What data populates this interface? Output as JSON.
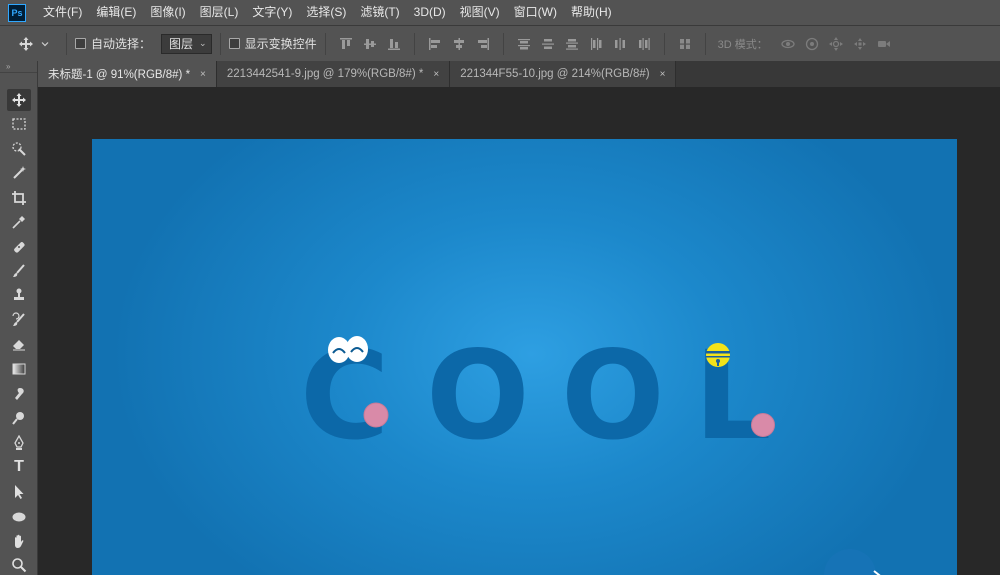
{
  "app": {
    "logo_text": "Ps",
    "brand_color": "#31a8ff"
  },
  "menu": [
    "文件(F)",
    "编辑(E)",
    "图像(I)",
    "图层(L)",
    "文字(Y)",
    "选择(S)",
    "滤镜(T)",
    "3D(D)",
    "视图(V)",
    "窗口(W)",
    "帮助(H)"
  ],
  "options": {
    "auto_select_label": "自动选择：",
    "auto_select_target": "图层",
    "show_transform_label": "显示变换控件",
    "mode_3d_label": "3D 模式："
  },
  "tabs": [
    {
      "label": "未标题-1 @ 91%(RGB/8#) *",
      "active": true,
      "close": "×"
    },
    {
      "label": "2213442541-9.jpg @ 179%(RGB/8#) *",
      "active": false,
      "close": "×"
    },
    {
      "label": "221344F55-10.jpg @ 214%(RGB/8#)",
      "active": false,
      "close": "×"
    }
  ],
  "toolbar": {
    "header": "»",
    "tools": [
      "move-tool",
      "marquee-tool",
      "lasso-tool",
      "magic-wand-tool",
      "crop-tool",
      "eyedropper-tool",
      "healing-brush-tool",
      "brush-tool",
      "clone-stamp-tool",
      "history-brush-tool",
      "eraser-tool",
      "gradient-tool",
      "blur-tool",
      "dodge-tool",
      "pen-tool",
      "type-tool",
      "path-selection-tool",
      "ellipse-tool",
      "hand-tool",
      "zoom-tool"
    ],
    "type_tool_glyph": "T"
  },
  "canvas_art": {
    "letters": [
      "C",
      "O",
      "O",
      "L"
    ],
    "letter_color": "#0c68a8",
    "cheek_color": "#d98aa8",
    "bell_color": "#f3e31a"
  },
  "colors": {
    "ui_panel": "#535353",
    "workspace": "#282828",
    "canvas_center": "#2e9fe2",
    "canvas_edge": "#1272b2"
  }
}
